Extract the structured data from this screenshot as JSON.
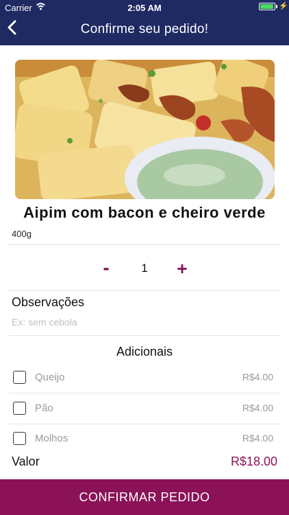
{
  "status_bar": {
    "carrier": "Carrier",
    "time": "2:05 AM"
  },
  "header": {
    "title": "Confirme seu pedido!"
  },
  "product": {
    "name": "Aipim com bacon e cheiro verde",
    "weight": "400g"
  },
  "quantity": {
    "minus": "-",
    "value": "1",
    "plus": "+"
  },
  "observations": {
    "label": "Observações",
    "placeholder": "Ex: sem cebola"
  },
  "addons": {
    "title": "Adicionais",
    "items": [
      {
        "name": "Queijo",
        "price": "R$4.00"
      },
      {
        "name": "Pão",
        "price": "R$4.00"
      },
      {
        "name": "Molhos",
        "price": "R$4.00"
      }
    ]
  },
  "total": {
    "label": "Valor",
    "value": "R$18.00"
  },
  "confirm": {
    "label": "CONFIRMAR PEDIDO"
  },
  "colors": {
    "header": "#1f2a63",
    "accent": "#8b1257"
  }
}
